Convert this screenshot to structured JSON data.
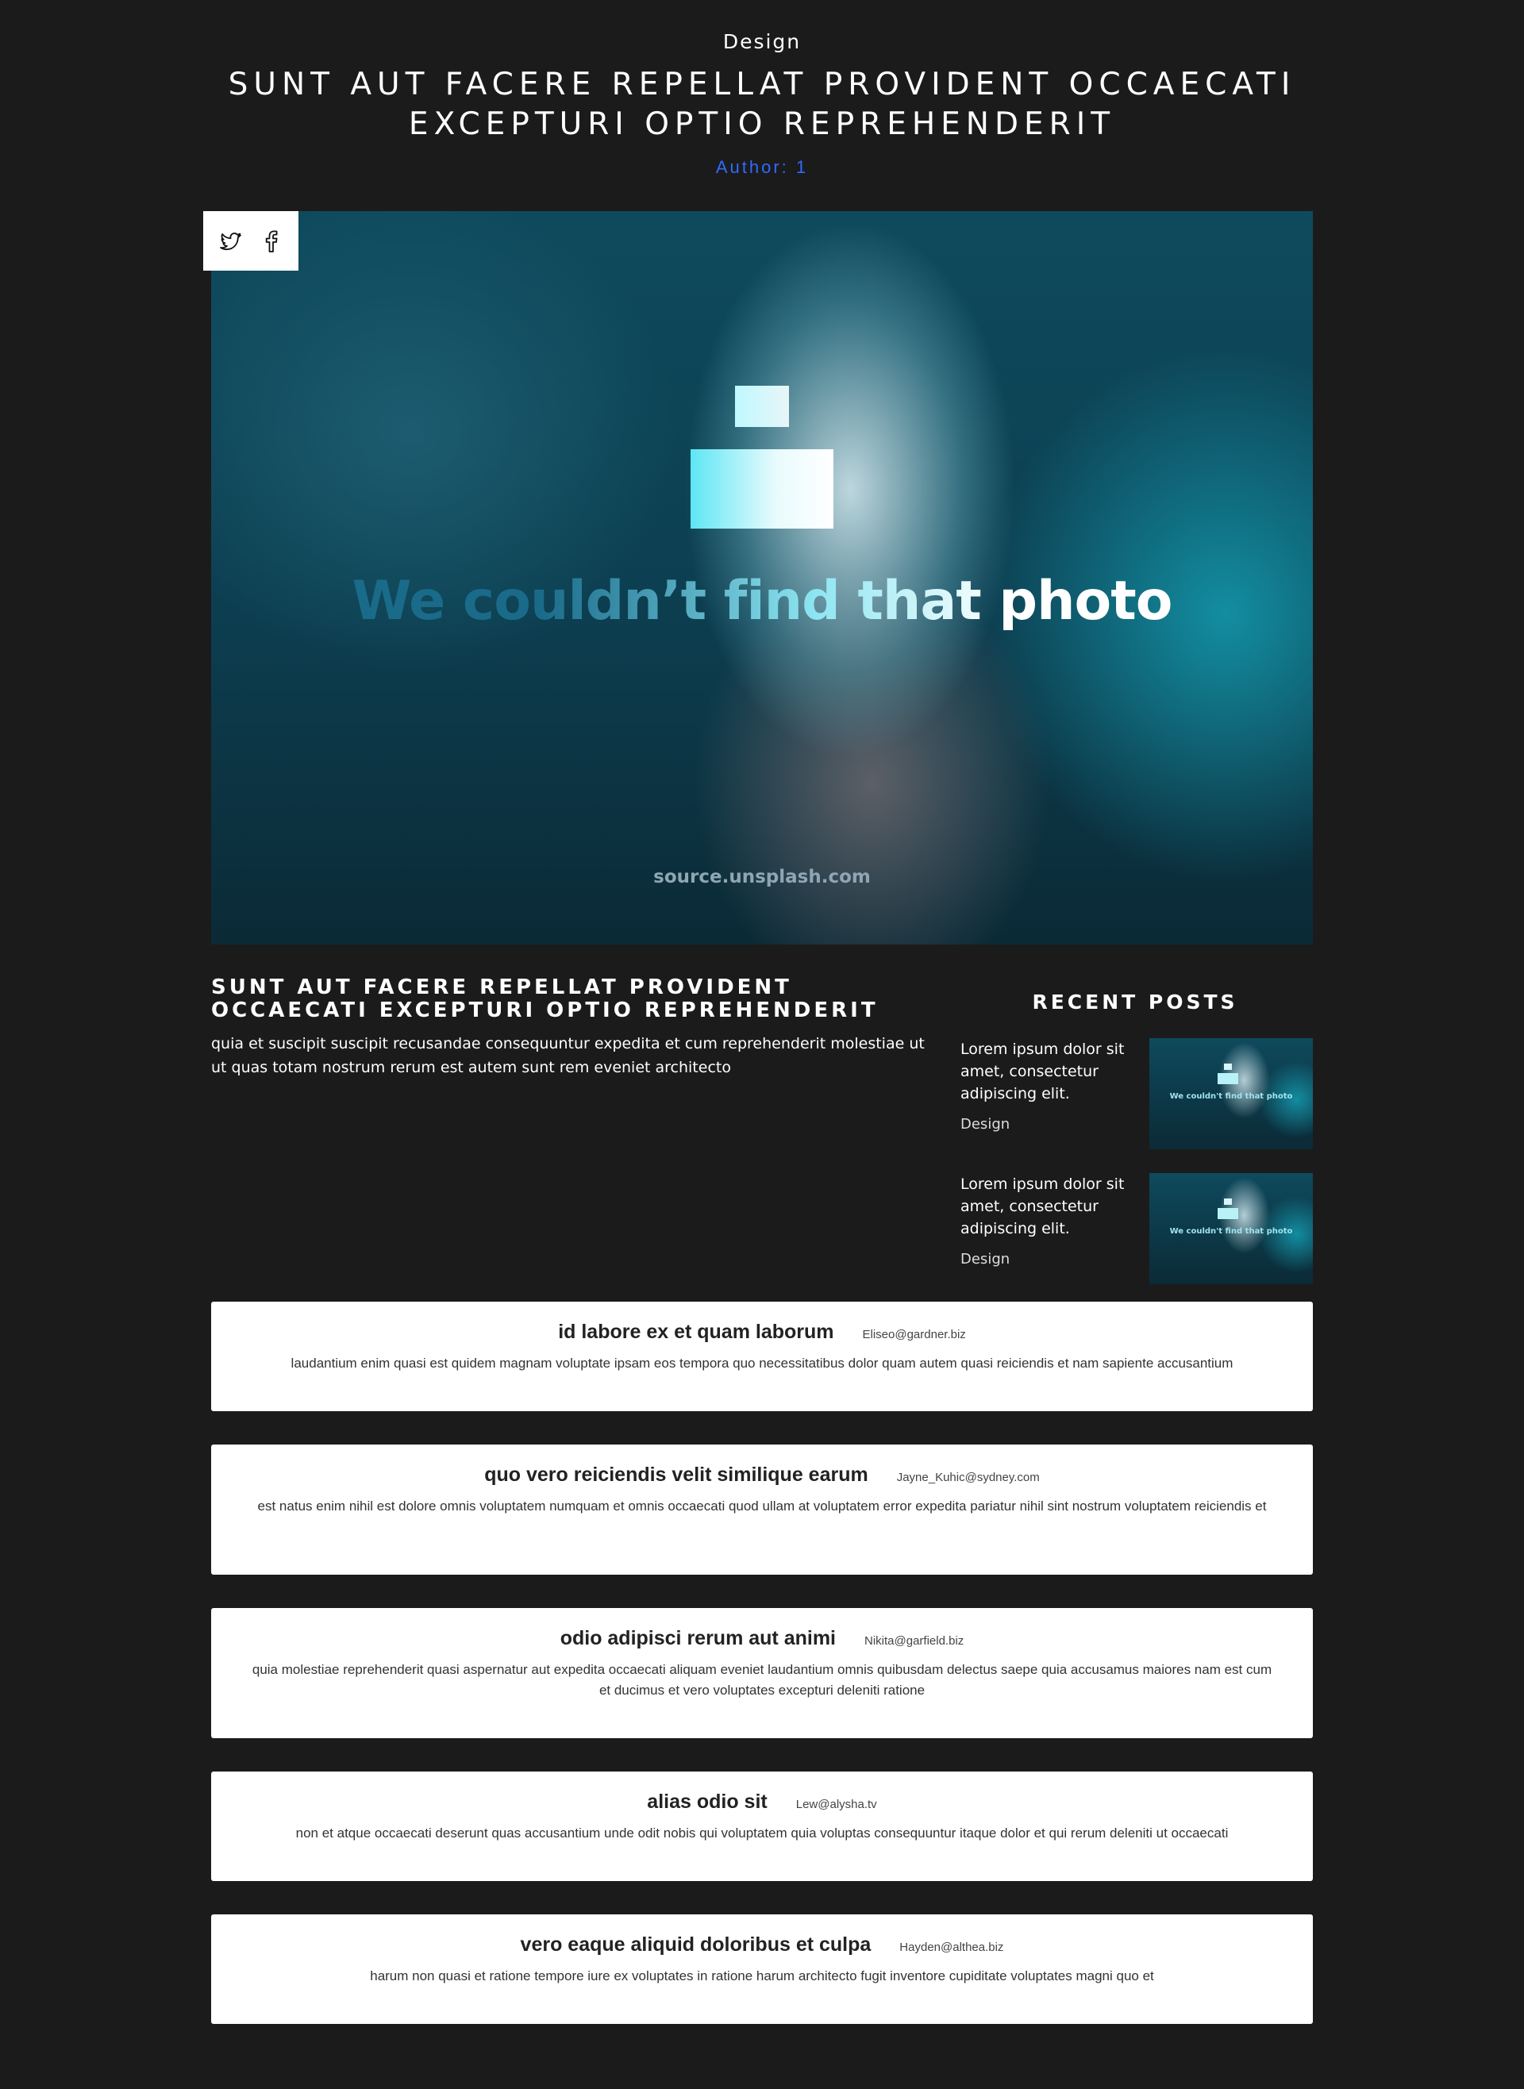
{
  "header": {
    "category": "Design",
    "title": "SUNT AUT FACERE REPELLAT PROVIDENT OCCAECATI EXCEPTURI OPTIO REPREHENDERIT",
    "author": "Author: 1"
  },
  "share": {
    "icons": [
      "twitter-icon",
      "facebook-icon"
    ]
  },
  "hero_image": {
    "message": "We couldn’t find that photo",
    "source": "source.unsplash.com"
  },
  "post": {
    "title": "SUNT AUT FACERE REPELLAT PROVIDENT OCCAECATI EXCEPTURI OPTIO REPREHENDERIT",
    "body": "quia et suscipit suscipit recusandae consequuntur expedita et cum reprehenderit molestiae ut ut quas totam nostrum rerum est autem sunt rem eveniet architecto"
  },
  "recent_posts": {
    "heading": "RECENT POSTS",
    "items": [
      {
        "text": "Lorem ipsum dolor sit amet, consectetur adipiscing elit.",
        "category": "Design",
        "thumb_text": "We couldn't find that photo"
      },
      {
        "text": "Lorem ipsum dolor sit amet, consectetur adipiscing elit.",
        "category": "Design",
        "thumb_text": "We couldn't find that photo"
      }
    ]
  },
  "comments": [
    {
      "name": "id labore ex et quam laborum",
      "email": "Eliseo@gardner.biz",
      "body": "laudantium enim quasi est quidem magnam voluptate ipsam eos tempora quo necessitatibus dolor quam autem quasi reiciendis et nam sapiente accusantium"
    },
    {
      "name": "quo vero reiciendis velit similique earum",
      "email": "Jayne_Kuhic@sydney.com",
      "body": "est natus enim nihil est dolore omnis voluptatem numquam et omnis occaecati quod ullam at voluptatem error expedita pariatur nihil sint nostrum voluptatem reiciendis et"
    },
    {
      "name": "odio adipisci rerum aut animi",
      "email": "Nikita@garfield.biz",
      "body": "quia molestiae reprehenderit quasi aspernatur aut expedita occaecati aliquam eveniet laudantium omnis quibusdam delectus saepe quia accusamus maiores nam est cum et ducimus et vero voluptates excepturi deleniti ratione"
    },
    {
      "name": "alias odio sit",
      "email": "Lew@alysha.tv",
      "body": "non et atque occaecati deserunt quas accusantium unde odit nobis qui voluptatem quia voluptas consequuntur itaque dolor et qui rerum deleniti ut occaecati"
    },
    {
      "name": "vero eaque aliquid doloribus et culpa",
      "email": "Hayden@althea.biz",
      "body": "harum non quasi et ratione tempore iure ex voluptates in ratione harum architecto fugit inventore cupiditate voluptates magni quo et"
    }
  ],
  "colors": {
    "background": "#1c1b1c",
    "author_link": "#2f6bff",
    "card": "#ffffff"
  }
}
